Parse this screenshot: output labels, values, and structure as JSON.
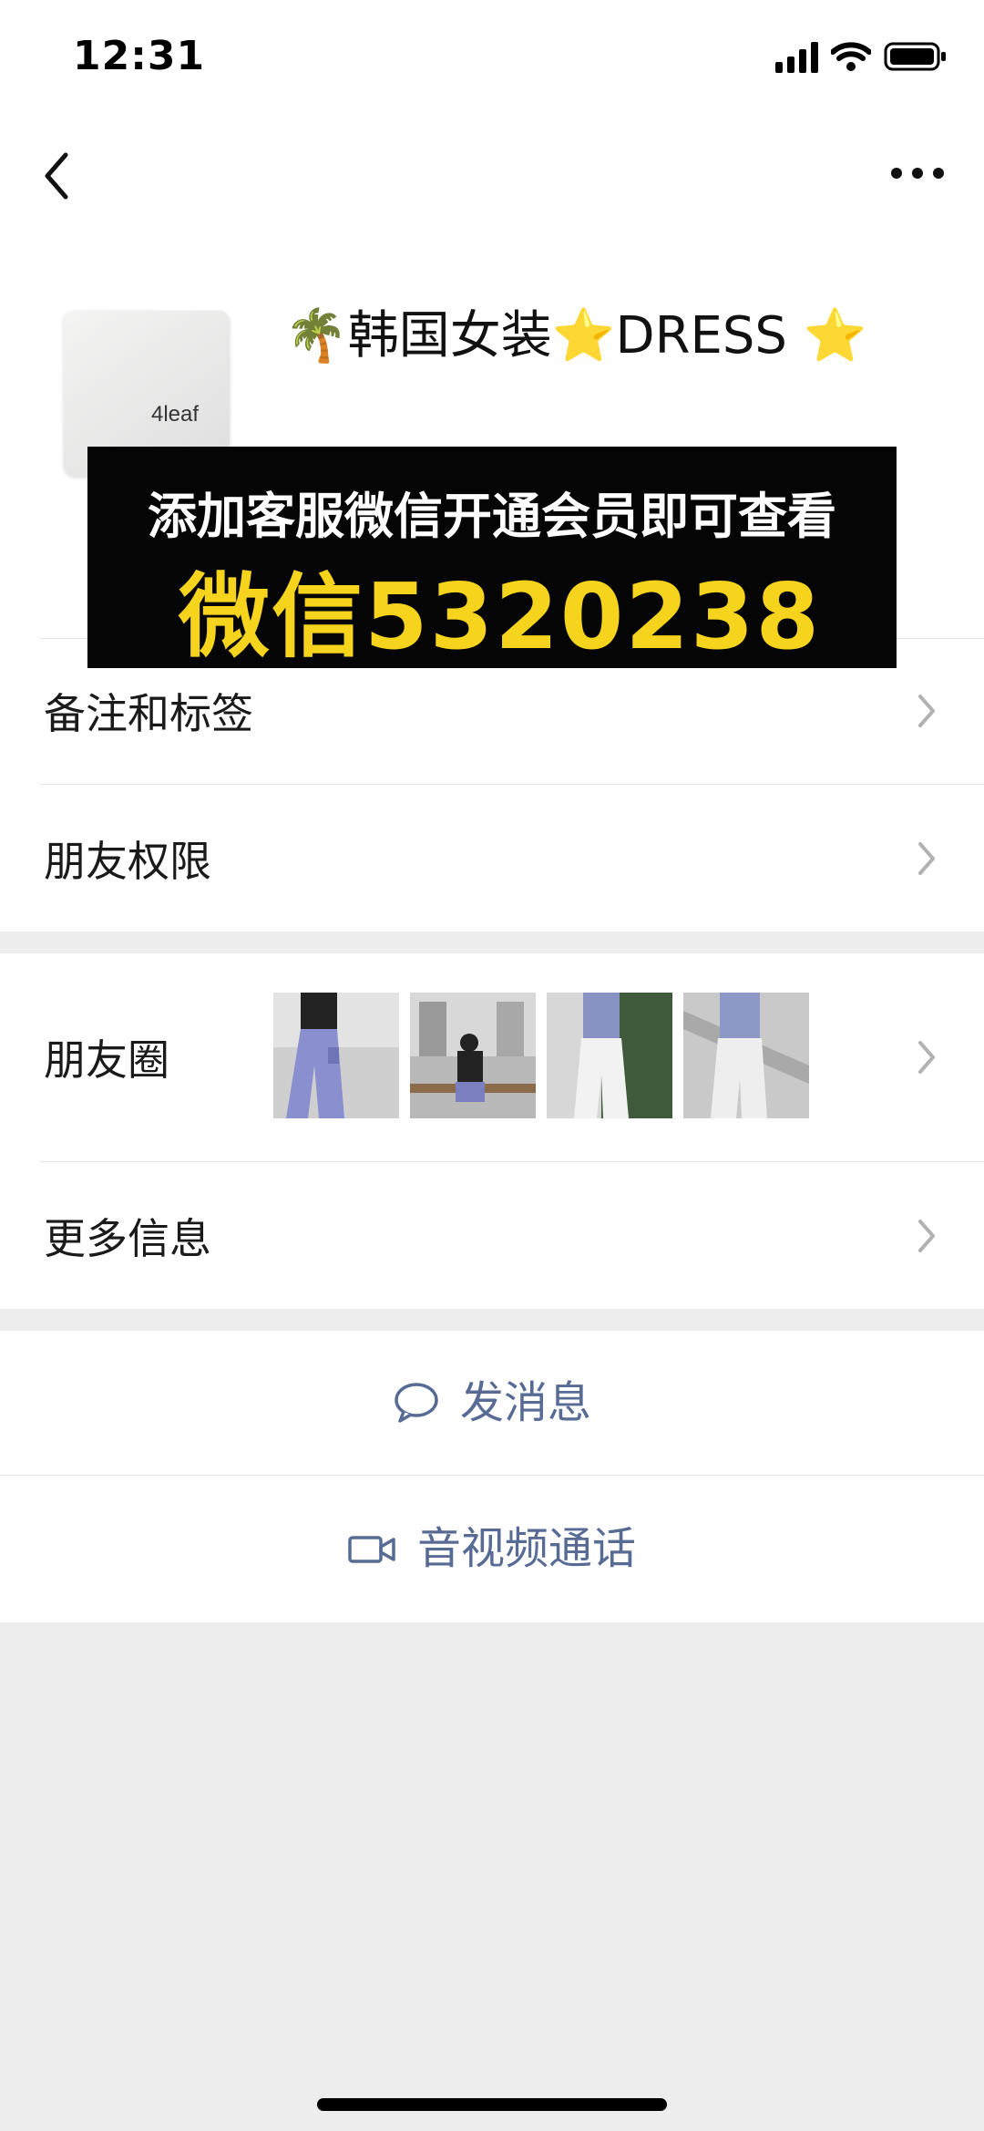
{
  "status_bar": {
    "time": "12:31"
  },
  "profile": {
    "name": "🌴韩国女装⭐DRESS ⭐",
    "avatar_text": "4leaf"
  },
  "promo": {
    "line1": "添加客服微信开通会员即可查看",
    "line2": "微信5320238"
  },
  "rows": {
    "remarks": "备注和标签",
    "permissions": "朋友权限",
    "moments": "朋友圈",
    "more_info": "更多信息"
  },
  "actions": {
    "message": "发消息",
    "call": "音视频通话"
  },
  "colors": {
    "link": "#576b95",
    "promo_yellow": "#f6d31c",
    "background": "#ededed"
  }
}
